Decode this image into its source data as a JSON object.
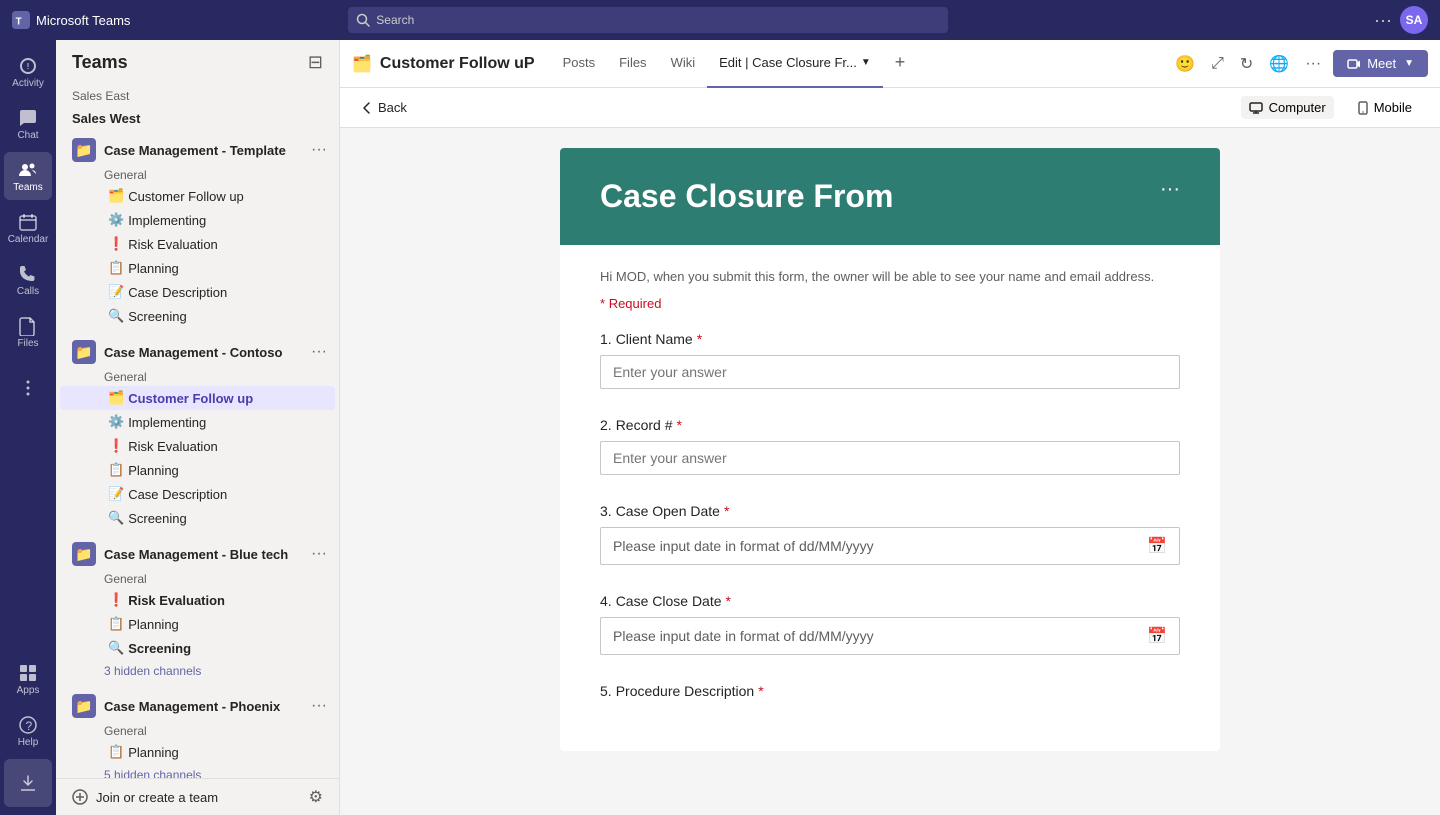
{
  "titlebar": {
    "app_name": "Microsoft Teams",
    "search_placeholder": "Search"
  },
  "sidebar": {
    "title": "Teams",
    "icon_items": [
      {
        "id": "activity",
        "label": "Activity",
        "icon": "activity"
      },
      {
        "id": "chat",
        "label": "Chat",
        "icon": "chat"
      },
      {
        "id": "teams",
        "label": "Teams",
        "icon": "teams",
        "active": true
      },
      {
        "id": "calendar",
        "label": "Calendar",
        "icon": "calendar"
      },
      {
        "id": "calls",
        "label": "Calls",
        "icon": "calls"
      },
      {
        "id": "files",
        "label": "Files",
        "icon": "files"
      }
    ],
    "bottom_icons": [
      {
        "id": "apps",
        "label": "Apps",
        "icon": "apps"
      },
      {
        "id": "help",
        "label": "Help",
        "icon": "help"
      },
      {
        "id": "download",
        "label": "Download",
        "icon": "download"
      }
    ],
    "sections": [
      {
        "id": "sales-west",
        "label": "Sales West",
        "teams": [
          {
            "id": "case-mgmt-template",
            "name": "Case Management - Template",
            "group": "General",
            "channels": [
              {
                "id": "cfu1",
                "name": "Customer Follow up",
                "emoji": "🗂️"
              },
              {
                "id": "impl1",
                "name": "Implementing",
                "emoji": "⚙️"
              },
              {
                "id": "risk1",
                "name": "Risk Evaluation",
                "emoji": "❗"
              },
              {
                "id": "plan1",
                "name": "Planning",
                "emoji": "📋"
              },
              {
                "id": "casedesc1",
                "name": "Case Description",
                "emoji": "📝"
              },
              {
                "id": "screen1",
                "name": "Screening",
                "emoji": "🔍"
              }
            ]
          },
          {
            "id": "case-mgmt-contoso",
            "name": "Case Management - Contoso",
            "group": "General",
            "channels": [
              {
                "id": "cfu2",
                "name": "Customer Follow up",
                "emoji": "🗂️",
                "active": true
              },
              {
                "id": "impl2",
                "name": "Implementing",
                "emoji": "⚙️"
              },
              {
                "id": "risk2",
                "name": "Risk Evaluation",
                "emoji": "❗"
              },
              {
                "id": "plan2",
                "name": "Planning",
                "emoji": "📋"
              },
              {
                "id": "casedesc2",
                "name": "Case Description",
                "emoji": "📝"
              },
              {
                "id": "screen2",
                "name": "Screening",
                "emoji": "🔍"
              }
            ]
          },
          {
            "id": "case-mgmt-bluetech",
            "name": "Case Management - Blue tech",
            "group": "General",
            "channels": [
              {
                "id": "risk3",
                "name": "Risk Evaluation",
                "emoji": "❗",
                "bold": true
              },
              {
                "id": "plan3",
                "name": "Planning",
                "emoji": "📋"
              },
              {
                "id": "screen3",
                "name": "Screening",
                "emoji": "🔍",
                "bold": true
              }
            ],
            "hidden_channels": "3 hidden channels"
          },
          {
            "id": "case-mgmt-phoenix",
            "name": "Case Management - Phoenix",
            "group": "General",
            "channels": [
              {
                "id": "plan4",
                "name": "Planning",
                "emoji": "📋"
              }
            ],
            "hidden_channels": "5 hidden channels"
          }
        ]
      }
    ],
    "join_team": "Join or create a team"
  },
  "channel_header": {
    "icon": "🗂️",
    "name": "Customer Follow uP",
    "nav_items": [
      {
        "id": "posts",
        "label": "Posts"
      },
      {
        "id": "files",
        "label": "Files"
      },
      {
        "id": "wiki",
        "label": "Wiki"
      },
      {
        "id": "edit",
        "label": "Edit | Case Closure Fr...",
        "active": true
      }
    ],
    "meet_label": "Meet"
  },
  "form_nav": {
    "back_label": "Back",
    "computer_label": "Computer",
    "mobile_label": "Mobile"
  },
  "form": {
    "title": "Case Closure From",
    "info_text": "Hi MOD, when you submit this form, the owner will be able to see your name and email address.",
    "required_label": "Required",
    "questions": [
      {
        "id": "q1",
        "number": "1",
        "label": "Client Name",
        "required": true,
        "type": "text",
        "placeholder": "Enter your answer"
      },
      {
        "id": "q2",
        "number": "2",
        "label": "Record #",
        "required": true,
        "type": "text",
        "placeholder": "Enter your answer"
      },
      {
        "id": "q3",
        "number": "3",
        "label": "Case Open Date",
        "required": true,
        "type": "date",
        "placeholder": "Please input date in format of dd/MM/yyyy"
      },
      {
        "id": "q4",
        "number": "4",
        "label": "Case Close Date",
        "required": true,
        "type": "date",
        "placeholder": "Please input date in format of dd/MM/yyyy"
      },
      {
        "id": "q5",
        "number": "5",
        "label": "Procedure Description",
        "required": true,
        "type": "text",
        "placeholder": ""
      }
    ]
  }
}
